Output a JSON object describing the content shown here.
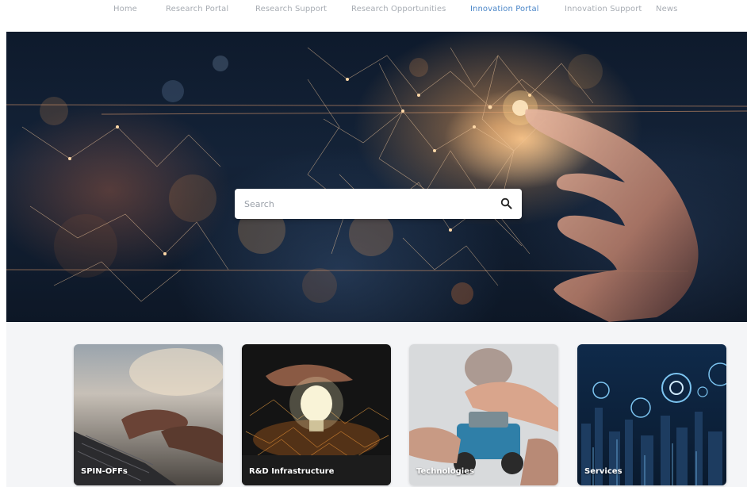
{
  "nav": {
    "items": [
      {
        "label": "Home",
        "active": false
      },
      {
        "label": "Research Portal",
        "active": false
      },
      {
        "label": "Research Support",
        "active": false
      },
      {
        "label": "Research Opportunities",
        "active": false
      },
      {
        "label": "Innovation Portal",
        "active": true
      },
      {
        "label": "Innovation Support",
        "active": false
      },
      {
        "label": "News",
        "active": false
      }
    ],
    "active_color": "#4a86c8",
    "inactive_color": "#a7acb3"
  },
  "hero": {
    "search": {
      "placeholder": "Search",
      "icon": "search-icon"
    }
  },
  "cards": [
    {
      "label": "SPIN-OFFs",
      "image": "laptop-typing-photo"
    },
    {
      "label": "R&D Infrastructure",
      "image": "lightbulb-hands-photo"
    },
    {
      "label": "Technologies",
      "image": "robot-kit-photo"
    },
    {
      "label": "Services",
      "image": "city-tech-icons-photo"
    }
  ]
}
